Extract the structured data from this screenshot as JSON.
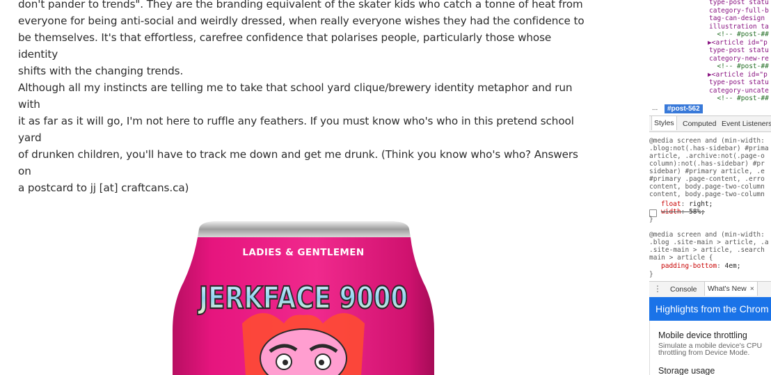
{
  "article": {
    "p1": [
      "don't pander to trends\". They are the branding equivalent of the skater kids who catch a tonne of heat from",
      "everyone for being anti-social and weirdly dressed, when really everyone wishes they had the confidence to",
      "be themselves. It's that effortless, carefree confidence that polarises people, particularly those whose identity",
      "shifts with the changing trends."
    ],
    "p2": [
      "Although all my instincts are telling me to take that school yard clique/brewery identity metaphor and run with",
      "it as far as it will go, I'm not here to ruffle any feathers. If you must know who's who in this pretend school yard",
      "of drunken children, you'll have to track me down and get me drunk. (Think you know who's who? Answers on",
      "a postcard to jj [at] craftcans.ca)"
    ],
    "can": {
      "top_text": "LADIES & GENTLEMEN",
      "brand": "JERKFACE 9000",
      "color_can": "#e6157e",
      "color_rim": "#c9c9c9"
    }
  },
  "devtools": {
    "elements_lines": [
      {
        "text": "type-post statu",
        "cls": "c-purple"
      },
      {
        "text": "category-full-b",
        "cls": "c-purple"
      },
      {
        "text": "tag-can-design",
        "cls": "c-purple"
      },
      {
        "text": "illustration ta",
        "cls": "c-purple"
      },
      {
        "text": "  <!-- #post-##",
        "cls": "c-green"
      },
      {
        "text": "▶<article id=\"p",
        "cls": "c-tag"
      },
      {
        "text": "type-post statu",
        "cls": "c-purple"
      },
      {
        "text": "category-new-re",
        "cls": "c-purple"
      },
      {
        "text": "  <!-- #post-##",
        "cls": "c-green"
      },
      {
        "text": "▶<article id=\"p",
        "cls": "c-tag"
      },
      {
        "text": "type-post statu",
        "cls": "c-purple"
      },
      {
        "text": "category-uncate",
        "cls": "c-purple"
      },
      {
        "text": "  <!-- #post-##",
        "cls": "c-green"
      }
    ],
    "breadcrumb": {
      "dots": "...",
      "selected": "#post-562"
    },
    "tabs": {
      "styles": "Styles",
      "computed": "Computed",
      "event_listeners": "Event Listeners"
    },
    "style_rules": {
      "media1": "@media screen and (min-width:",
      "sel1": [
        ".blog:not(.has-sidebar) #prima",
        "article, .archive:not(.page-o",
        "column):not(.has-sidebar) #pr",
        "sidebar) #primary article, .e",
        "#primary .page-content, .erro",
        "content, body.page-two-column",
        "content, body.page-two-column"
      ],
      "float_prop": "float",
      "float_val": "right;",
      "width_prop": "width",
      "width_val": "58%;",
      "close1": "}",
      "media2": "@media screen and (min-width:",
      "sel2": [
        ".blog .site-main > article, .a",
        ".site-main > article, .search",
        "main > article {"
      ],
      "pad_prop": "padding-bottom",
      "pad_val": "4em;",
      "close2": "}"
    },
    "drawer": {
      "menu_icon": "⋮",
      "console": "Console",
      "whats_new": "What's New",
      "close": "×"
    },
    "highlights_title": "Highlights from the Chrom",
    "whatsnew": {
      "h1": "Mobile device throttling",
      "desc": "Simulate a mobile device's CPU throttling from Device Mode.",
      "h2": "Storage usage"
    }
  }
}
